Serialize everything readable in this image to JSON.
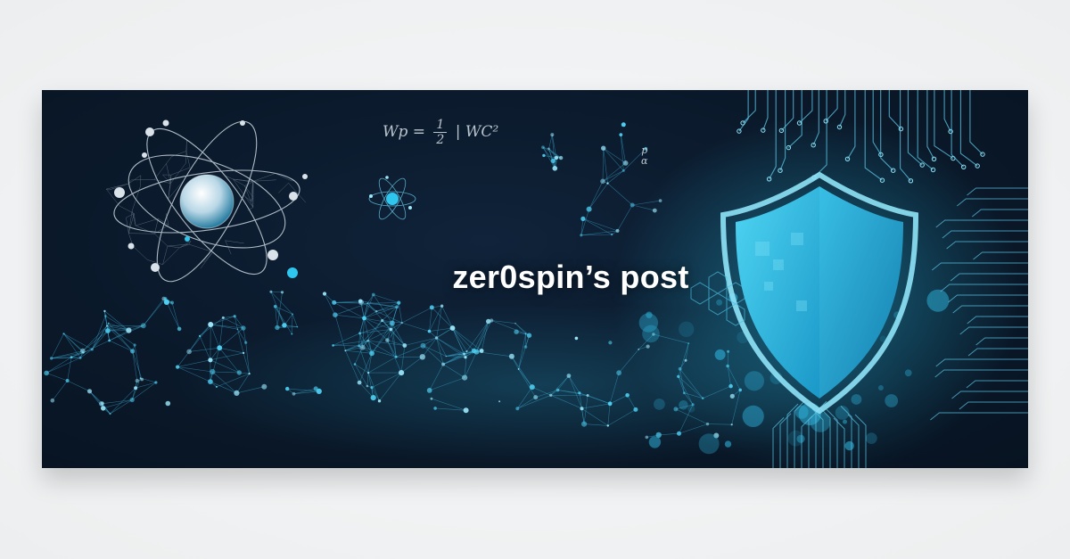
{
  "banner": {
    "title": "zer0spin’s post",
    "formula": {
      "lhs": "Wp =",
      "numerator": "1",
      "denominator": "2",
      "rhs": "| WC²"
    },
    "mini_formula": {
      "top": "p",
      "bottom": "α"
    }
  },
  "colors": {
    "background": "#0b1a2c",
    "accent": "#29c4ea",
    "shield": "#2fb6dd",
    "outer": "#eef0f1"
  },
  "icons": [
    "atom-icon",
    "small-atom-icon",
    "shield-icon",
    "circuit-traces-icon",
    "network-graph-icon"
  ]
}
